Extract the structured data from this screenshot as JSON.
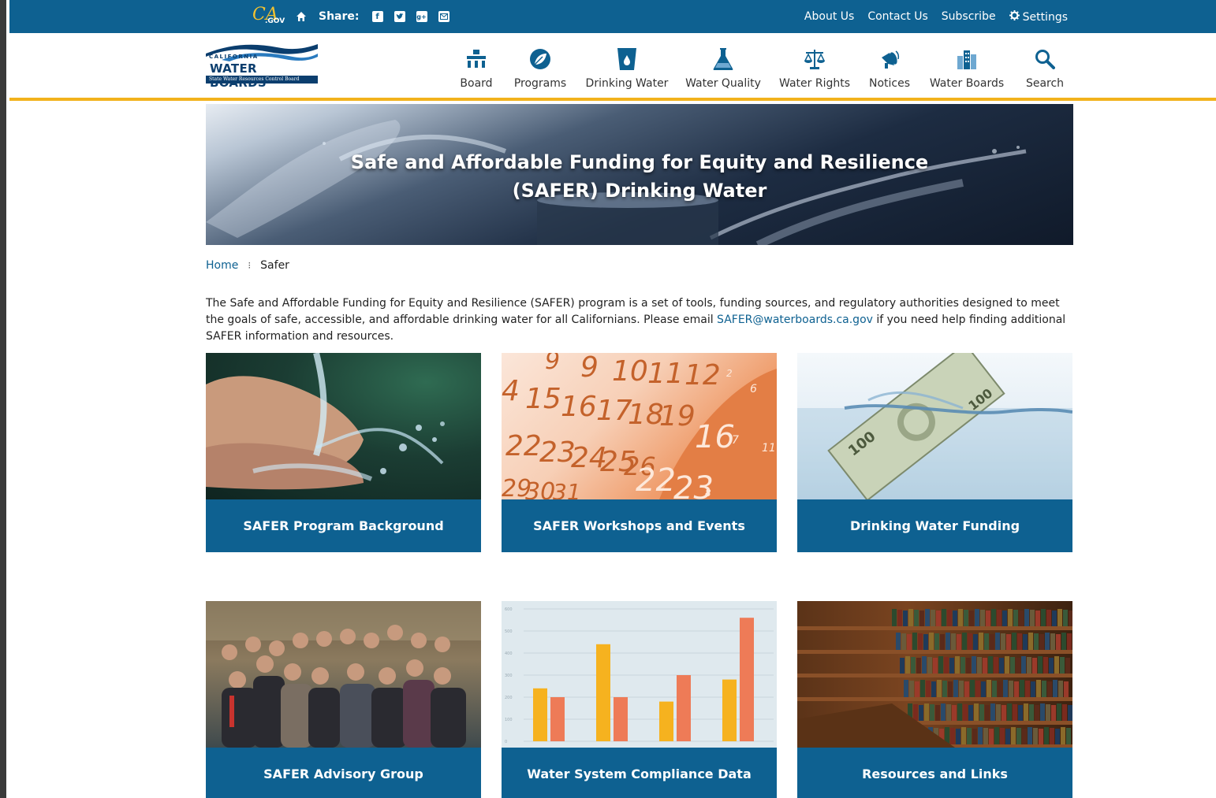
{
  "utility_bar": {
    "ca_logo_text": "CA",
    "ca_logo_sub": ".GOV",
    "share_label": "Share:",
    "links": [
      "About Us",
      "Contact Us",
      "Subscribe",
      "Settings"
    ],
    "color": "#0e6191"
  },
  "logo": {
    "top_text": "CALIFORNIA",
    "main_text": "WATER BOARDS",
    "sub_text": "State Water Resources Control Board"
  },
  "nav": {
    "items": [
      {
        "label": "Board",
        "icon": "board-icon"
      },
      {
        "label": "Programs",
        "icon": "programs-icon"
      },
      {
        "label": "Drinking Water",
        "icon": "drinking-water-icon"
      },
      {
        "label": "Water Quality",
        "icon": "water-quality-icon"
      },
      {
        "label": "Water Rights",
        "icon": "water-rights-icon"
      },
      {
        "label": "Notices",
        "icon": "notices-icon"
      },
      {
        "label": "Water Boards",
        "icon": "water-boards-icon"
      },
      {
        "label": "Search",
        "icon": "search-icon"
      }
    ],
    "accent": "#f2b21c"
  },
  "hero": {
    "title": "Safe and Affordable Funding for Equity and Resilience (SAFER) Drinking Water"
  },
  "breadcrumb": {
    "home": "Home",
    "separator": "⁝",
    "current": "Safer"
  },
  "intro": {
    "text_before": "The Safe and Affordable Funding for Equity and Resilience (SAFER) program is a set of tools, funding sources, and regulatory authorities designed to meet the goals of safe, accessible, and affordable drinking water for all Californians. Please email ",
    "email": "SAFER@waterboards.ca.gov",
    "text_after": " if you need help finding additional SAFER information and resources."
  },
  "tiles": [
    {
      "label": "SAFER Program Background"
    },
    {
      "label": "SAFER Workshops and Events"
    },
    {
      "label": "Drinking Water Funding"
    },
    {
      "label": "SAFER Advisory Group"
    },
    {
      "label": "Water System Compliance Data"
    },
    {
      "label": "Resources and Links"
    }
  ],
  "calendar_numbers": [
    "9",
    "10",
    "11",
    "12",
    "4",
    "15",
    "16",
    "17",
    "18",
    "19",
    "22",
    "23",
    "24",
    "25",
    "26",
    "22",
    "23",
    "16",
    "29",
    "30",
    "31",
    "6",
    "7",
    "11",
    "8",
    "2"
  ],
  "compliance_chart": {
    "axis_labels": [
      "600",
      "500",
      "400",
      "300",
      "200",
      "100",
      "0"
    ],
    "bars": [
      {
        "yellow": 240,
        "orange": 200
      },
      {
        "yellow": 440,
        "orange": 200
      },
      {
        "yellow": 180,
        "orange": 300
      },
      {
        "yellow": 280,
        "orange": 560
      }
    ],
    "yellow": "#f6b21f",
    "orange": "#ee7b57"
  }
}
